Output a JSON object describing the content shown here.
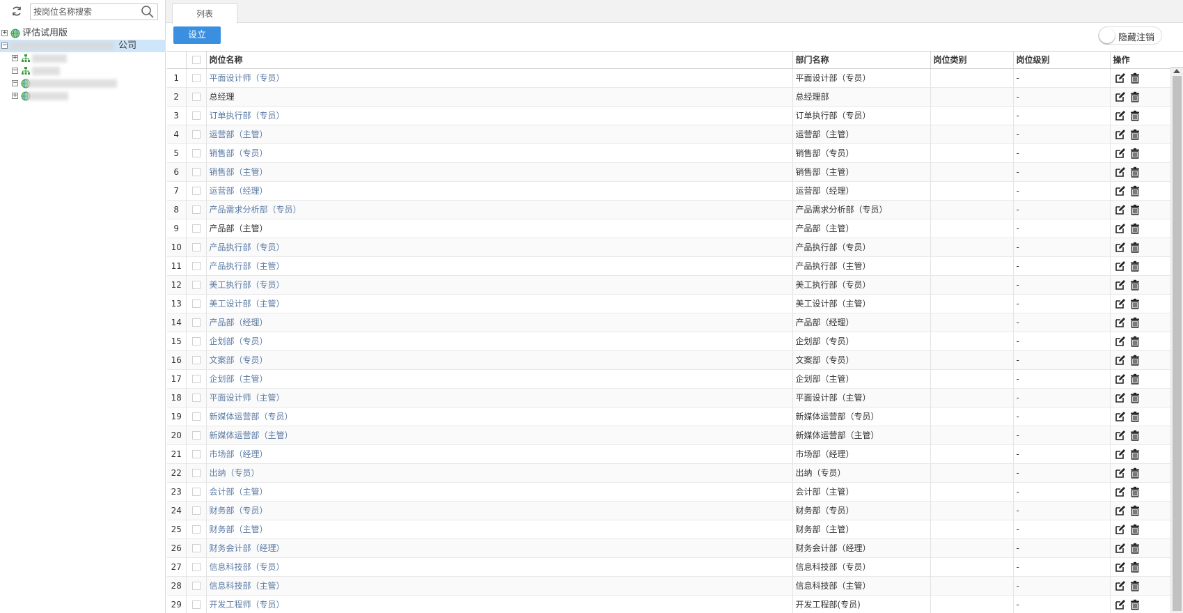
{
  "search": {
    "placeholder": "按岗位名称搜索"
  },
  "tree": {
    "root_label": "评估试用版",
    "company_suffix": "公司"
  },
  "tabs": [
    {
      "label": "列表"
    }
  ],
  "toolbar": {
    "setup_label": "设立",
    "hide_cancel_label": "隐藏注销"
  },
  "table": {
    "columns": [
      "岗位名称",
      "部门名称",
      "岗位类别",
      "岗位级别",
      "操作"
    ],
    "rows": [
      {
        "no": "1",
        "position": "平面设计师（专员）",
        "dept": "平面设计部（专员）",
        "category": "",
        "level": "-"
      },
      {
        "no": "2",
        "position": "总经理",
        "dept": "总经理部",
        "category": "",
        "level": "-"
      },
      {
        "no": "3",
        "position": "订单执行部（专员）",
        "dept": "订单执行部（专员）",
        "category": "",
        "level": "-"
      },
      {
        "no": "4",
        "position": "运营部（主管）",
        "dept": "运营部（主管）",
        "category": "",
        "level": "-"
      },
      {
        "no": "5",
        "position": "销售部（专员）",
        "dept": "销售部（专员）",
        "category": "",
        "level": "-"
      },
      {
        "no": "6",
        "position": "销售部（主管）",
        "dept": "销售部（主管）",
        "category": "",
        "level": "-"
      },
      {
        "no": "7",
        "position": "运营部（经理）",
        "dept": "运营部（经理）",
        "category": "",
        "level": "-"
      },
      {
        "no": "8",
        "position": "产品需求分析部（专员）",
        "dept": "产品需求分析部（专员）",
        "category": "",
        "level": "-"
      },
      {
        "no": "9",
        "position": "产品部（主管）",
        "dept": "产品部（主管）",
        "category": "",
        "level": "-"
      },
      {
        "no": "10",
        "position": "产品执行部（专员）",
        "dept": "产品执行部（专员）",
        "category": "",
        "level": "-"
      },
      {
        "no": "11",
        "position": "产品执行部（主管）",
        "dept": "产品执行部（主管）",
        "category": "",
        "level": "-"
      },
      {
        "no": "12",
        "position": "美工执行部（专员）",
        "dept": "美工执行部（专员）",
        "category": "",
        "level": "-"
      },
      {
        "no": "13",
        "position": "美工设计部（主管）",
        "dept": "美工设计部（主管）",
        "category": "",
        "level": "-"
      },
      {
        "no": "14",
        "position": "产品部（经理）",
        "dept": "产品部（经理）",
        "category": "",
        "level": "-"
      },
      {
        "no": "15",
        "position": "企划部（专员）",
        "dept": "企划部（专员）",
        "category": "",
        "level": "-"
      },
      {
        "no": "16",
        "position": "文案部（专员）",
        "dept": "文案部（专员）",
        "category": "",
        "level": "-"
      },
      {
        "no": "17",
        "position": "企划部（主管）",
        "dept": "企划部（主管）",
        "category": "",
        "level": "-"
      },
      {
        "no": "18",
        "position": "平面设计师（主管）",
        "dept": "平面设计部（主管）",
        "category": "",
        "level": "-"
      },
      {
        "no": "19",
        "position": "新媒体运营部（专员）",
        "dept": "新媒体运营部（专员）",
        "category": "",
        "level": "-"
      },
      {
        "no": "20",
        "position": "新媒体运营部（主管）",
        "dept": "新媒体运营部（主管）",
        "category": "",
        "level": "-"
      },
      {
        "no": "21",
        "position": "市场部（经理）",
        "dept": "市场部（经理）",
        "category": "",
        "level": "-"
      },
      {
        "no": "22",
        "position": "出纳（专员）",
        "dept": "出纳（专员）",
        "category": "",
        "level": "-"
      },
      {
        "no": "23",
        "position": "会计部（主管）",
        "dept": "会计部（主管）",
        "category": "",
        "level": "-"
      },
      {
        "no": "24",
        "position": "财务部（专员）",
        "dept": "财务部（专员）",
        "category": "",
        "level": "-"
      },
      {
        "no": "25",
        "position": "财务部（主管）",
        "dept": "财务部（主管）",
        "category": "",
        "level": "-"
      },
      {
        "no": "26",
        "position": "财务会计部（经理）",
        "dept": "财务会计部（经理）",
        "category": "",
        "level": "-"
      },
      {
        "no": "27",
        "position": "信息科技部（专员）",
        "dept": "信息科技部（专员）",
        "category": "",
        "level": "-"
      },
      {
        "no": "28",
        "position": "信息科技部（主管）",
        "dept": "信息科技部（主管）",
        "category": "",
        "level": "-"
      },
      {
        "no": "29",
        "position": "开发工程师（专员）",
        "dept": "开发工程部(专员)",
        "category": "",
        "level": "-"
      }
    ]
  },
  "icons": {
    "refresh": "refresh-icon",
    "search": "search-icon",
    "edit": "edit-icon",
    "delete": "trash-icon",
    "tree_globe": "globe-icon",
    "tree_org": "org-chart-icon"
  },
  "colors": {
    "accent": "#3b8fe0",
    "link": "#5a7aa4",
    "selected_node": "#cfe6fa"
  }
}
